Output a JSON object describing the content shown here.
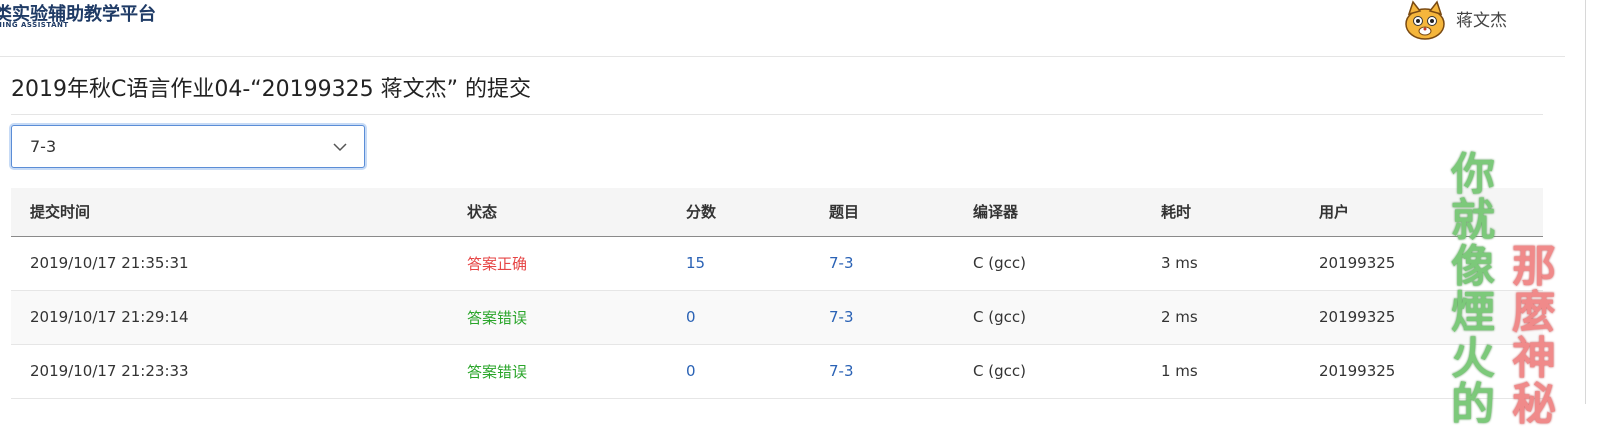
{
  "header": {
    "logo_title": "类实验辅助教学平台",
    "logo_sub": "HING ASSISTANT",
    "username": "蒋文杰",
    "avatar_icon": "cat-avatar-icon"
  },
  "page": {
    "title": "2019年秋C语言作业04-“20199325 蒋文杰” 的提交"
  },
  "filter": {
    "selected": "7-3",
    "icon": "chevron-down-icon"
  },
  "table": {
    "headers": [
      "提交时间",
      "状态",
      "分数",
      "题目",
      "编译器",
      "耗时",
      "用户"
    ],
    "rows": [
      {
        "time": "2019/10/17 21:35:31",
        "status": "答案正确",
        "score": "15",
        "problem": "7-3",
        "compiler": "C (gcc)",
        "duration": "3 ms",
        "user": "20199325"
      },
      {
        "time": "2019/10/17 21:29:14",
        "status": "答案错误",
        "score": "0",
        "problem": "7-3",
        "compiler": "C (gcc)",
        "duration": "2 ms",
        "user": "20199325"
      },
      {
        "time": "2019/10/17 21:23:33",
        "status": "答案错误",
        "score": "0",
        "problem": "7-3",
        "compiler": "C (gcc)",
        "duration": "1 ms",
        "user": "20199325"
      }
    ]
  },
  "overlay": {
    "green_text": "你就像煙火的",
    "red_text": "那麼神秘"
  },
  "colors": {
    "accepted": "#e64545",
    "wrong": "#2aa52a",
    "link": "#2a62b5",
    "brand": "#1f3b66"
  }
}
